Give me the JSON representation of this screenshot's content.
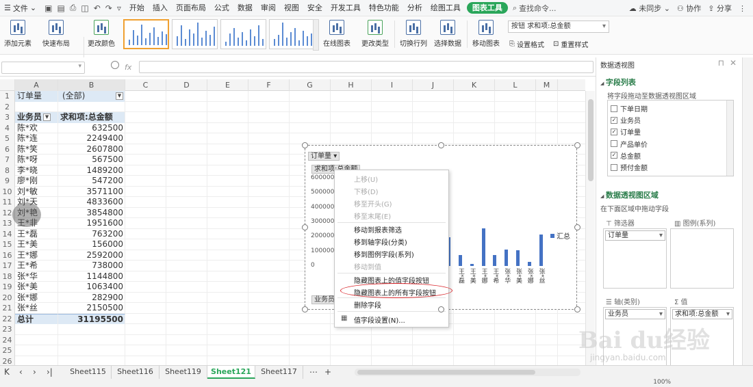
{
  "menubar": {
    "file_label": "文件",
    "items": [
      "开始",
      "插入",
      "页面布局",
      "公式",
      "数据",
      "审阅",
      "视图",
      "安全",
      "开发工具",
      "特色功能",
      "分析",
      "绘图工具",
      "图表工具"
    ],
    "search_label": "查找命令...",
    "sync_label": "未同步",
    "collab_label": "协作",
    "share_label": "分享"
  },
  "toolbar": {
    "add_element": "添加元素",
    "quick_layout": "快速布局",
    "change_color": "更改颜色",
    "online_chart": "在线图表",
    "change_type": "更改类型",
    "switch_rowcol": "切换行列",
    "select_data": "选择数据",
    "move_chart": "移动图表",
    "element_select": "按钮 求和项:总金额",
    "set_format": "设置格式",
    "reset_style": "重置样式"
  },
  "grid": {
    "columns": [
      "A",
      "B",
      "C",
      "D",
      "E",
      "F",
      "G",
      "H",
      "I",
      "J",
      "K",
      "L",
      "M"
    ],
    "rows": [
      {
        "n": "1",
        "a": "订单量",
        "b": "(全部)",
        "type": "filter"
      },
      {
        "n": "2",
        "a": "",
        "b": ""
      },
      {
        "n": "3",
        "a": "业务员",
        "b": "求和项:总金额",
        "type": "header"
      },
      {
        "n": "4",
        "a": "陈*欢",
        "b": "632500"
      },
      {
        "n": "5",
        "a": "陈*连",
        "b": "2249400"
      },
      {
        "n": "6",
        "a": "陈*笑",
        "b": "2607800"
      },
      {
        "n": "7",
        "a": "陈*呀",
        "b": "567500"
      },
      {
        "n": "8",
        "a": "李*晓",
        "b": "1489200"
      },
      {
        "n": "9",
        "a": "廖*刚",
        "b": "547200"
      },
      {
        "n": "10",
        "a": "刘*敏",
        "b": "3571100"
      },
      {
        "n": "11",
        "a": "刘*天",
        "b": "4833600"
      },
      {
        "n": "12",
        "a": "刘*艳",
        "b": "3854800"
      },
      {
        "n": "13",
        "a": "王*非",
        "b": "1951600"
      },
      {
        "n": "14",
        "a": "王*磊",
        "b": "763200"
      },
      {
        "n": "15",
        "a": "王*美",
        "b": "156000"
      },
      {
        "n": "16",
        "a": "王*娜",
        "b": "2592000"
      },
      {
        "n": "17",
        "a": "王*希",
        "b": "738000"
      },
      {
        "n": "18",
        "a": "张*华",
        "b": "1144800"
      },
      {
        "n": "19",
        "a": "张*美",
        "b": "1063400"
      },
      {
        "n": "20",
        "a": "张*娜",
        "b": "282900"
      },
      {
        "n": "21",
        "a": "张*丝",
        "b": "2150500"
      },
      {
        "n": "22",
        "a": "总计",
        "b": "31195500",
        "type": "total"
      },
      {
        "n": "23",
        "a": "",
        "b": ""
      },
      {
        "n": "24",
        "a": "",
        "b": ""
      },
      {
        "n": "25",
        "a": "",
        "b": ""
      },
      {
        "n": "26",
        "a": "",
        "b": ""
      },
      {
        "n": "27",
        "a": "",
        "b": ""
      },
      {
        "n": "28",
        "a": "",
        "b": ""
      }
    ]
  },
  "chart": {
    "filter_button": "订单量",
    "value_button": "求和项:总金额",
    "axis_button": "业务员",
    "legend_label": "汇总",
    "yticks": [
      "6000000",
      "5000000",
      "4000000",
      "3000000",
      "2000000",
      "1000000",
      "0"
    ],
    "visible_xlabels": [
      "王*磊",
      "王*美",
      "王*娜",
      "王*希",
      "张*华",
      "张*美",
      "张*娜",
      "张*丝"
    ]
  },
  "chart_data": {
    "type": "bar",
    "categories": [
      "陈*欢",
      "陈*连",
      "陈*笑",
      "陈*呀",
      "李*晓",
      "廖*刚",
      "刘*敏",
      "刘*天",
      "刘*艳",
      "王*非",
      "王*磊",
      "王*美",
      "王*娜",
      "王*希",
      "张*华",
      "张*美",
      "张*娜",
      "张*丝"
    ],
    "series": [
      {
        "name": "汇总",
        "values": [
          632500,
          2249400,
          2607800,
          567500,
          1489200,
          547200,
          3571100,
          4833600,
          3854800,
          1951600,
          763200,
          156000,
          2592000,
          738000,
          1144800,
          1063400,
          282900,
          2150500
        ]
      }
    ],
    "ylim": [
      0,
      6000000
    ],
    "legend": "right"
  },
  "context_menu": {
    "items": [
      {
        "label": "上移(U)",
        "disabled": true
      },
      {
        "label": "下移(D)",
        "disabled": true
      },
      {
        "label": "移至开头(G)",
        "disabled": true
      },
      {
        "label": "移至末尾(E)",
        "disabled": true
      },
      {
        "label": "移动到报表筛选",
        "disabled": false
      },
      {
        "label": "移到轴字段(分类)",
        "disabled": false
      },
      {
        "label": "移到图例字段(系列)",
        "disabled": false
      },
      {
        "label": "移动到值",
        "disabled": true
      },
      {
        "label": "隐藏图表上的值字段按钮",
        "disabled": false
      },
      {
        "label": "隐藏图表上的所有字段按钮",
        "disabled": false
      },
      {
        "label": "删除字段",
        "disabled": false
      },
      {
        "label": "值字段设置(N)...",
        "disabled": false
      }
    ]
  },
  "panel": {
    "title": "数据透视图",
    "field_list_title": "字段列表",
    "field_list_hint": "将字段拖动至数据透视图区域",
    "fields": [
      {
        "label": "下单日期",
        "checked": false
      },
      {
        "label": "业务员",
        "checked": true
      },
      {
        "label": "订单量",
        "checked": true
      },
      {
        "label": "产品单价",
        "checked": false
      },
      {
        "label": "总金额",
        "checked": true
      },
      {
        "label": "预付金额",
        "checked": false
      }
    ],
    "area_title": "数据透视图区域",
    "area_hint": "在下面区域中拖动字段",
    "filter_label": "筛选器",
    "legend_label": "图例(系列)",
    "axis_label": "轴(类别)",
    "values_label": "值",
    "filter_item": "订单量",
    "axis_item": "业务员",
    "values_item": "求和项:总金额"
  },
  "sheets": {
    "tabs": [
      "Sheet115",
      "Sheet116",
      "Sheet119",
      "Sheet121",
      "Sheet117"
    ],
    "active": "Sheet121"
  },
  "status": {
    "zoom": "100%"
  },
  "watermark": {
    "text": "Bai du经验",
    "url": "jingyan.baidu.com"
  }
}
